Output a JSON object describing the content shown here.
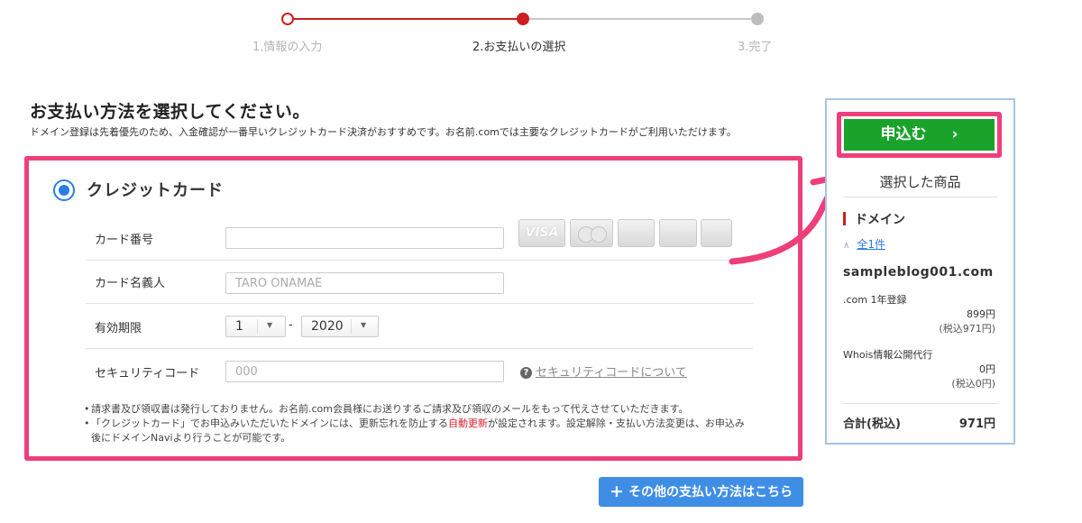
{
  "stepper": {
    "steps": [
      {
        "label": "1.情報の入力",
        "state": "done"
      },
      {
        "label": "2.お支払いの選択",
        "state": "current"
      },
      {
        "label": "3.完了",
        "state": "pending"
      }
    ]
  },
  "heading": {
    "title": "お支払い方法を選択してください。",
    "description": "ドメイン登録は先着優先のため、入金確認が一番早いクレジットカード決済がおすすめです。お名前.comでは主要なクレジットカードがご利用いただけます。"
  },
  "payment": {
    "method_label": "クレジットカード",
    "selected": true,
    "card_number": {
      "label": "カード番号",
      "value": "",
      "placeholder": ""
    },
    "card_brands": [
      "VISA",
      "MasterCard",
      "JCB",
      "Diners Club",
      "American Express"
    ],
    "card_holder": {
      "label": "カード名義人",
      "value": "",
      "placeholder": "TARO ONAMAE"
    },
    "expiry": {
      "label": "有効期限",
      "month": "1",
      "separator": "-",
      "year": "2020"
    },
    "security_code": {
      "label": "セキュリティコード",
      "value": "",
      "placeholder": "000",
      "help_link": "セキュリティコードについて"
    },
    "notes": {
      "note1": "請求書及び領収書は発行しておりません。お名前.com会員様にお送りするご請求及び領収のメールをもって代えさせていただきます。",
      "note2_before": "「クレジットカード」でお申込みいただいたドメインには、更新忘れを防止する",
      "note2_highlight": "自動更新",
      "note2_after": "が設定されます。設定解除・支払い方法変更は、お申込み後にドメインNaviより行うことが可能です。"
    }
  },
  "other_methods_button": "その他の支払い方法はこちら",
  "sidebar": {
    "apply_button": "申込む",
    "selected_title": "選択した商品",
    "category": "ドメイン",
    "count_link": "全1件",
    "domain": "sampleblog001.com",
    "items": [
      {
        "label": ".com 1年登録",
        "price": "899円",
        "tax_included": "(税込971円)"
      },
      {
        "label": "Whois情報公開代行",
        "price": "0円",
        "tax_included": "(税込0円)"
      }
    ],
    "total_label": "合計(税込)",
    "total_value": "971円"
  },
  "colors": {
    "accent_red": "#cc1f1f",
    "highlight_pink": "#ee3f7a",
    "apply_green": "#1aa32a",
    "link_blue": "#2a7de1",
    "other_button_blue": "#3f8ee6"
  },
  "icons": {
    "radio": "radio-selected-icon",
    "help": "question-circle-icon",
    "plus": "plus-icon",
    "chevron": "chevron-right-icon",
    "caret": "caret-up-icon"
  }
}
